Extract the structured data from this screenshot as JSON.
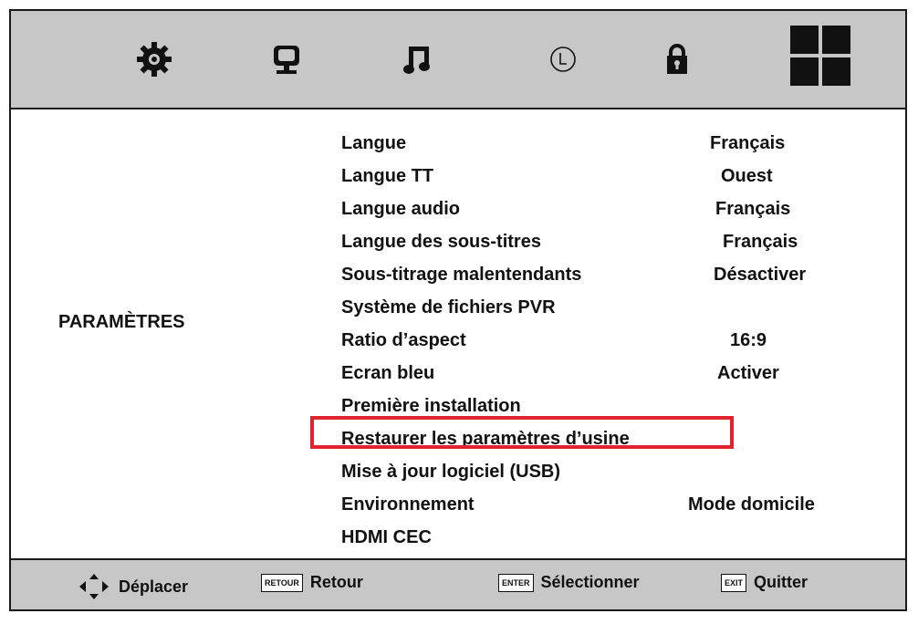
{
  "tabs": [
    {
      "icon": "settings-gear-icon"
    },
    {
      "icon": "display-monitor-icon"
    },
    {
      "icon": "music-note-icon"
    },
    {
      "icon": "clock-icon"
    },
    {
      "icon": "lock-icon"
    },
    {
      "icon": "windows-grid-icon"
    }
  ],
  "section_title": "PARAMÈTRES",
  "menu": [
    {
      "label": "Langue",
      "value": "Français"
    },
    {
      "label": "Langue TT",
      "value": "Ouest"
    },
    {
      "label": "Langue audio",
      "value": "Français"
    },
    {
      "label": "Langue des sous-titres",
      "value": "Français"
    },
    {
      "label": "Sous-titrage malentendants",
      "value": "Désactiver"
    },
    {
      "label": "Système de fichiers PVR",
      "value": ""
    },
    {
      "label": "Ratio d’aspect",
      "value": "16:9"
    },
    {
      "label": "Ecran bleu",
      "value": "Activer"
    },
    {
      "label": "Première installation",
      "value": ""
    },
    {
      "label": "Restaurer les paramètres d’usine",
      "value": "",
      "highlighted": true
    },
    {
      "label": "Mise à jour logiciel (USB)",
      "value": ""
    },
    {
      "label": "Environnement",
      "value": "Mode domicile"
    },
    {
      "label": "HDMI CEC",
      "value": ""
    }
  ],
  "footer": {
    "move": {
      "label": "Déplacer"
    },
    "back": {
      "key": "RETOUR",
      "label": "Retour"
    },
    "select": {
      "key": "ENTER",
      "label": "Sélectionner"
    },
    "exit": {
      "key": "EXIT",
      "label": "Quitter"
    }
  },
  "colors": {
    "bar": "#c7c7c7",
    "highlight": "#e0242f"
  }
}
